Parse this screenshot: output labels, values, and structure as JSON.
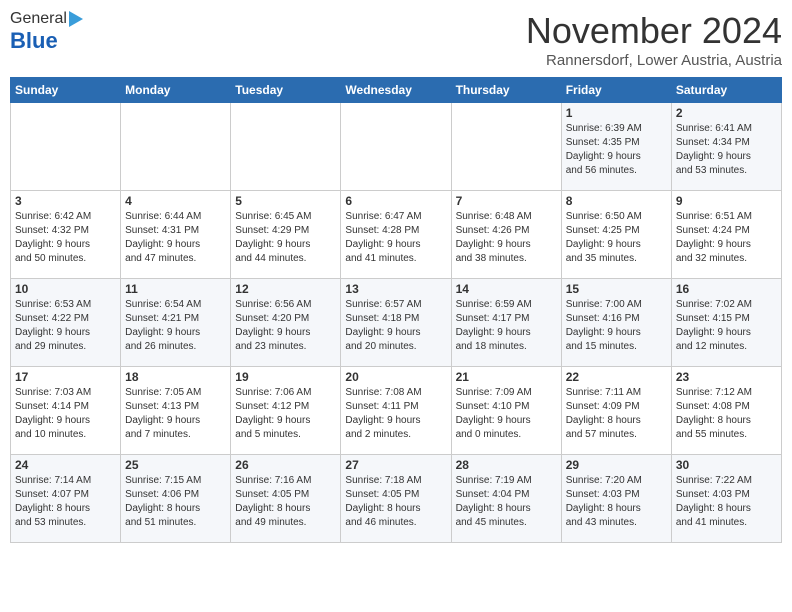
{
  "header": {
    "logo_general": "General",
    "logo_blue": "Blue",
    "month": "November 2024",
    "location": "Rannersdorf, Lower Austria, Austria"
  },
  "days_of_week": [
    "Sunday",
    "Monday",
    "Tuesday",
    "Wednesday",
    "Thursday",
    "Friday",
    "Saturday"
  ],
  "weeks": [
    [
      {
        "day": "",
        "detail": ""
      },
      {
        "day": "",
        "detail": ""
      },
      {
        "day": "",
        "detail": ""
      },
      {
        "day": "",
        "detail": ""
      },
      {
        "day": "",
        "detail": ""
      },
      {
        "day": "1",
        "detail": "Sunrise: 6:39 AM\nSunset: 4:35 PM\nDaylight: 9 hours\nand 56 minutes."
      },
      {
        "day": "2",
        "detail": "Sunrise: 6:41 AM\nSunset: 4:34 PM\nDaylight: 9 hours\nand 53 minutes."
      }
    ],
    [
      {
        "day": "3",
        "detail": "Sunrise: 6:42 AM\nSunset: 4:32 PM\nDaylight: 9 hours\nand 50 minutes."
      },
      {
        "day": "4",
        "detail": "Sunrise: 6:44 AM\nSunset: 4:31 PM\nDaylight: 9 hours\nand 47 minutes."
      },
      {
        "day": "5",
        "detail": "Sunrise: 6:45 AM\nSunset: 4:29 PM\nDaylight: 9 hours\nand 44 minutes."
      },
      {
        "day": "6",
        "detail": "Sunrise: 6:47 AM\nSunset: 4:28 PM\nDaylight: 9 hours\nand 41 minutes."
      },
      {
        "day": "7",
        "detail": "Sunrise: 6:48 AM\nSunset: 4:26 PM\nDaylight: 9 hours\nand 38 minutes."
      },
      {
        "day": "8",
        "detail": "Sunrise: 6:50 AM\nSunset: 4:25 PM\nDaylight: 9 hours\nand 35 minutes."
      },
      {
        "day": "9",
        "detail": "Sunrise: 6:51 AM\nSunset: 4:24 PM\nDaylight: 9 hours\nand 32 minutes."
      }
    ],
    [
      {
        "day": "10",
        "detail": "Sunrise: 6:53 AM\nSunset: 4:22 PM\nDaylight: 9 hours\nand 29 minutes."
      },
      {
        "day": "11",
        "detail": "Sunrise: 6:54 AM\nSunset: 4:21 PM\nDaylight: 9 hours\nand 26 minutes."
      },
      {
        "day": "12",
        "detail": "Sunrise: 6:56 AM\nSunset: 4:20 PM\nDaylight: 9 hours\nand 23 minutes."
      },
      {
        "day": "13",
        "detail": "Sunrise: 6:57 AM\nSunset: 4:18 PM\nDaylight: 9 hours\nand 20 minutes."
      },
      {
        "day": "14",
        "detail": "Sunrise: 6:59 AM\nSunset: 4:17 PM\nDaylight: 9 hours\nand 18 minutes."
      },
      {
        "day": "15",
        "detail": "Sunrise: 7:00 AM\nSunset: 4:16 PM\nDaylight: 9 hours\nand 15 minutes."
      },
      {
        "day": "16",
        "detail": "Sunrise: 7:02 AM\nSunset: 4:15 PM\nDaylight: 9 hours\nand 12 minutes."
      }
    ],
    [
      {
        "day": "17",
        "detail": "Sunrise: 7:03 AM\nSunset: 4:14 PM\nDaylight: 9 hours\nand 10 minutes."
      },
      {
        "day": "18",
        "detail": "Sunrise: 7:05 AM\nSunset: 4:13 PM\nDaylight: 9 hours\nand 7 minutes."
      },
      {
        "day": "19",
        "detail": "Sunrise: 7:06 AM\nSunset: 4:12 PM\nDaylight: 9 hours\nand 5 minutes."
      },
      {
        "day": "20",
        "detail": "Sunrise: 7:08 AM\nSunset: 4:11 PM\nDaylight: 9 hours\nand 2 minutes."
      },
      {
        "day": "21",
        "detail": "Sunrise: 7:09 AM\nSunset: 4:10 PM\nDaylight: 9 hours\nand 0 minutes."
      },
      {
        "day": "22",
        "detail": "Sunrise: 7:11 AM\nSunset: 4:09 PM\nDaylight: 8 hours\nand 57 minutes."
      },
      {
        "day": "23",
        "detail": "Sunrise: 7:12 AM\nSunset: 4:08 PM\nDaylight: 8 hours\nand 55 minutes."
      }
    ],
    [
      {
        "day": "24",
        "detail": "Sunrise: 7:14 AM\nSunset: 4:07 PM\nDaylight: 8 hours\nand 53 minutes."
      },
      {
        "day": "25",
        "detail": "Sunrise: 7:15 AM\nSunset: 4:06 PM\nDaylight: 8 hours\nand 51 minutes."
      },
      {
        "day": "26",
        "detail": "Sunrise: 7:16 AM\nSunset: 4:05 PM\nDaylight: 8 hours\nand 49 minutes."
      },
      {
        "day": "27",
        "detail": "Sunrise: 7:18 AM\nSunset: 4:05 PM\nDaylight: 8 hours\nand 46 minutes."
      },
      {
        "day": "28",
        "detail": "Sunrise: 7:19 AM\nSunset: 4:04 PM\nDaylight: 8 hours\nand 45 minutes."
      },
      {
        "day": "29",
        "detail": "Sunrise: 7:20 AM\nSunset: 4:03 PM\nDaylight: 8 hours\nand 43 minutes."
      },
      {
        "day": "30",
        "detail": "Sunrise: 7:22 AM\nSunset: 4:03 PM\nDaylight: 8 hours\nand 41 minutes."
      }
    ]
  ]
}
